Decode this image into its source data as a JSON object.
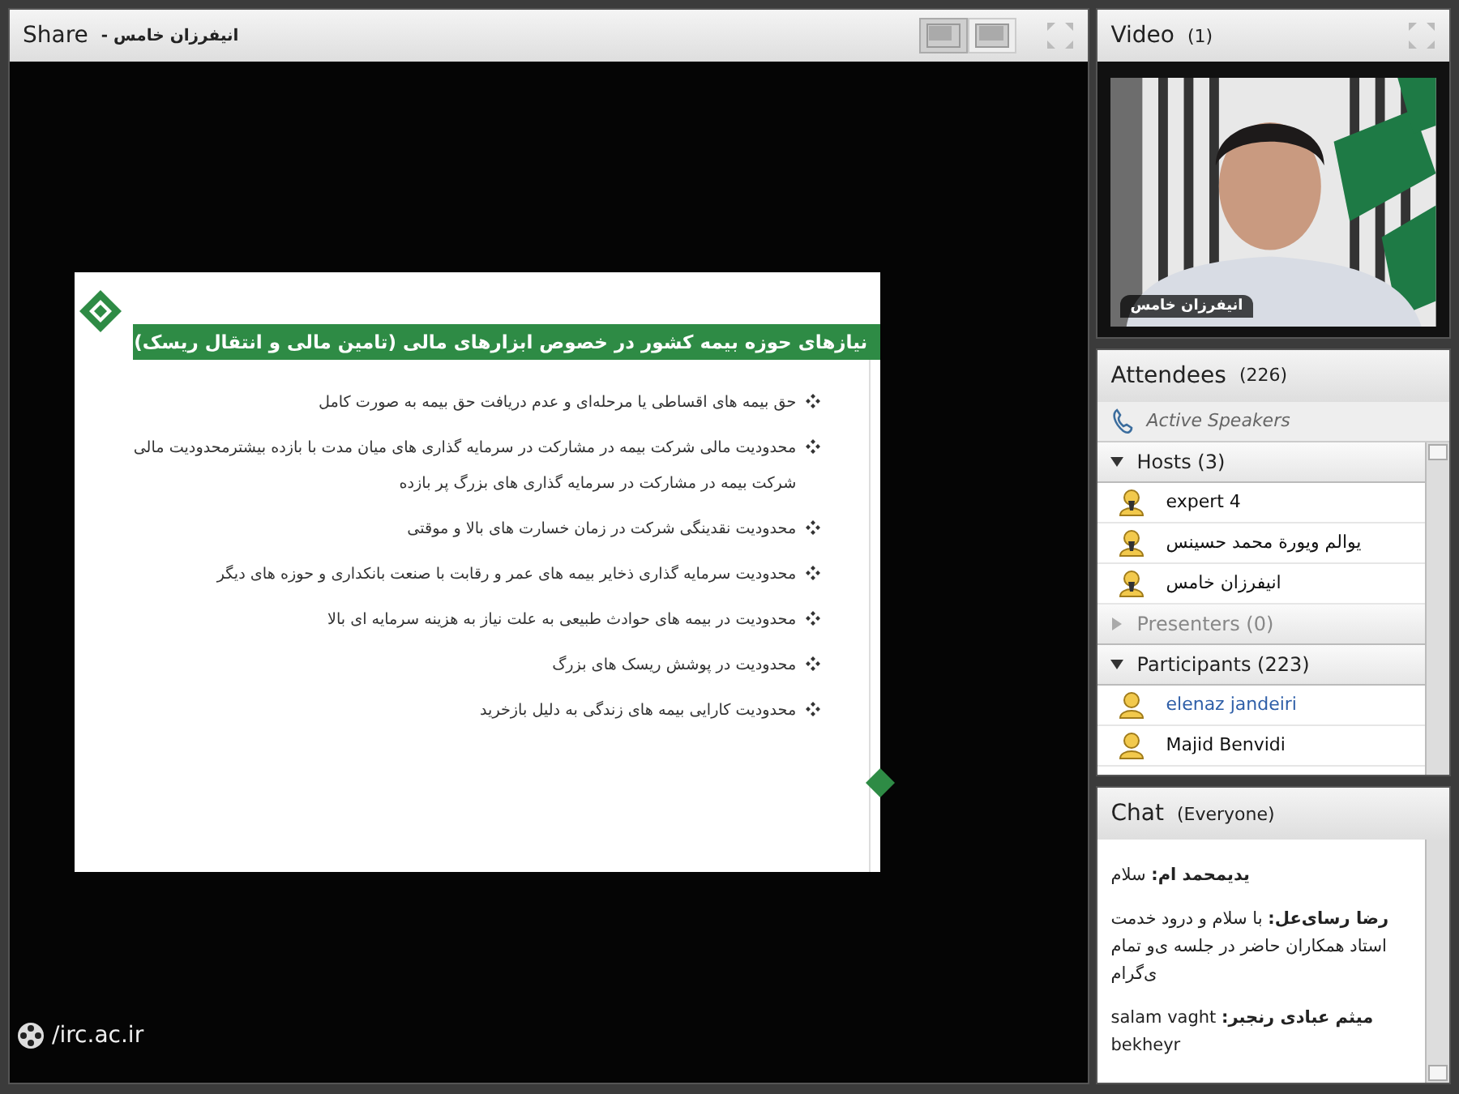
{
  "share_pod": {
    "title": "Share",
    "presenter": "- انیفرزان خامس",
    "layout_buttons": [
      {
        "selected": true
      },
      {
        "selected": false
      }
    ],
    "slide": {
      "title": "نیازهای حوزه بیمه کشور در خصوص ابزارهای مالی (تامین مالی و انتقال ریسک)",
      "bullets": [
        "حق بیمه های اقساطی یا مرحله‌ای و عدم دریافت حق بیمه به صورت کامل",
        "محدودیت مالی شرکت بیمه در مشارکت در سرمایه گذاری های میان مدت با بازده بیشترمحدودیت مالی شرکت بیمه در مشارکت در سرمایه گذاری های بزرگ پر بازده",
        "محدودیت نقدینگی شرکت در زمان خسارت های بالا و موقتی",
        "محدودیت سرمایه گذاری ذخایر بیمه های عمر و رقابت با صنعت بانکداری و حوزه های دیگر",
        "محدودیت در بیمه های حوادث طبیعی به علت نیاز به هزینه سرمایه ای بالا",
        "محدودیت در پوشش ریسک های بزرگ",
        "محدودیت کارایی بیمه های زندگی به دلیل بازخرید"
      ]
    },
    "footer": "/irc.ac.ir"
  },
  "video_pod": {
    "title": "Video",
    "count": "(1)",
    "video": {
      "kind": "picture",
      "caption": "انیفرزان خامس"
    }
  },
  "attendees_pod": {
    "title": "Attendees",
    "count": "(226)",
    "active_speakers": "Active Speakers",
    "groups": [
      {
        "label": "Hosts (3)",
        "expanded": true,
        "members": [
          {
            "name": "expert 4",
            "kind": "host",
            "highlighted": false
          },
          {
            "name": "یوالم ویورة محمد حسینس",
            "kind": "host",
            "highlighted": false
          },
          {
            "name": "انیفرزان خامس",
            "kind": "host",
            "highlighted": false
          }
        ]
      },
      {
        "label": "Presenters (0)",
        "expanded": false
      },
      {
        "label": "Participants (223)",
        "expanded": true,
        "members": [
          {
            "name": "elenaz jandeiri",
            "kind": "participant",
            "highlighted": true
          },
          {
            "name": "Majid Benvidi",
            "kind": "participant",
            "highlighted": false
          }
        ]
      }
    ]
  },
  "chat_pod": {
    "title": "Chat",
    "audience": "(Everyone)",
    "messages": [
      {
        "sender": "یدیمحمد ام:",
        "text": "سلام"
      },
      {
        "sender": "رضا رسای‌عل:",
        "text": "با سلام و درود خدمت استاد همکاران حاضر در جلسه ی‌و تمام ی‌گرام"
      },
      {
        "sender": "میثم عبادی رنجبر:",
        "text": "salam vaght bekheyr"
      }
    ]
  }
}
